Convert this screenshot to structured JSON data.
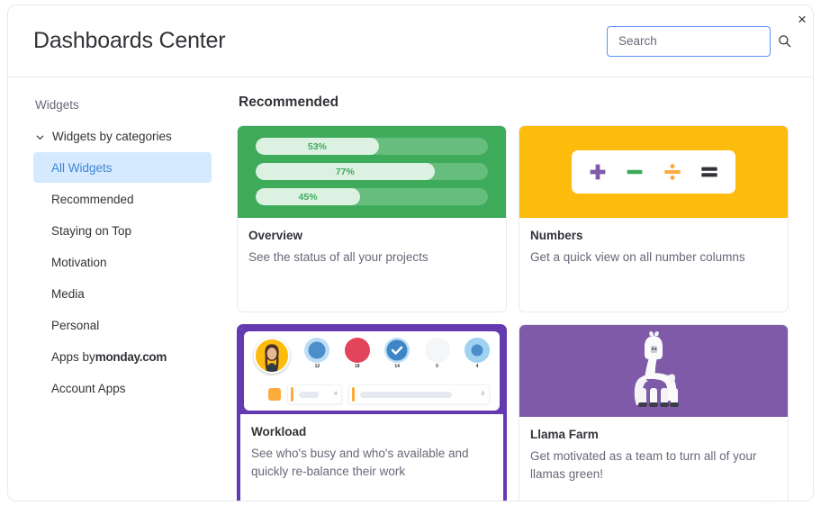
{
  "header": {
    "title": "Dashboards Center",
    "close_label": "×",
    "close_icon": "close-icon"
  },
  "search": {
    "placeholder": "Search",
    "value": "",
    "icon": "search-icon"
  },
  "sidebar": {
    "heading": "Widgets",
    "group": {
      "label": "Widgets by categories",
      "icon": "chevron-down-icon",
      "expanded": true
    },
    "items": [
      {
        "label": "All Widgets",
        "selected": true
      },
      {
        "label": "Recommended",
        "selected": false
      },
      {
        "label": "Staying on Top",
        "selected": false
      },
      {
        "label": "Motivation",
        "selected": false
      },
      {
        "label": "Media",
        "selected": false
      },
      {
        "label": "Personal",
        "selected": false
      },
      {
        "label": "Apps by ",
        "brand": "monday.com",
        "selected": false
      },
      {
        "label": "Account Apps",
        "selected": false
      }
    ]
  },
  "main": {
    "section_title": "Recommended",
    "overflow_dots": "··",
    "cards": [
      {
        "title": "Overview",
        "description": "See the status of all your projects",
        "media": "progress-bars",
        "accent": "#3dab5a",
        "bars": [
          {
            "label": "53%",
            "value": 53
          },
          {
            "label": "77%",
            "value": 77
          },
          {
            "label": "45%",
            "value": 45
          }
        ]
      },
      {
        "title": "Numbers",
        "description": "Get a quick view on all number columns",
        "media": "math-operators",
        "accent": "#fdbb0d",
        "operators": [
          {
            "name": "plus-icon",
            "symbol": "+",
            "color": "#7e5aa8"
          },
          {
            "name": "minus-icon",
            "symbol": "−",
            "color": "#3dab5a"
          },
          {
            "name": "divide-icon",
            "symbol": "÷",
            "color": "#fdab3d"
          },
          {
            "name": "equals-icon",
            "symbol": "=",
            "color": "#323338"
          }
        ]
      },
      {
        "title": "Workload",
        "description": "See who's busy and who's available and quickly re-balance their work",
        "media": "workload",
        "accent": "#643ab0",
        "outlined": true,
        "people": [
          {
            "type": "avatar",
            "color": "#fdbb0d",
            "count": ""
          },
          {
            "type": "circle",
            "color": "#4b8ec9",
            "ring": "#bcddf5",
            "count": "12"
          },
          {
            "type": "circle",
            "color": "#e2445c",
            "ring": "",
            "count": "18"
          },
          {
            "type": "circle-check",
            "color": "#3d85c6",
            "ring": "#bcddf5",
            "count": "14",
            "icon": "check-icon"
          },
          {
            "type": "circle-empty",
            "color": "#f5f6f8",
            "ring": "",
            "count": "0"
          },
          {
            "type": "circle",
            "color": "#4b8ec9",
            "ring": "#9fd2f0",
            "count": "4"
          }
        ],
        "bars": [
          {
            "fill": 34,
            "count": "4"
          },
          {
            "fill": 78,
            "count": "8"
          }
        ]
      },
      {
        "title": "Llama Farm",
        "description": "Get motivated as a team to turn all of your llamas green!",
        "media": "llama",
        "accent": "#7e5aa8",
        "icon": "llama-icon"
      }
    ]
  }
}
